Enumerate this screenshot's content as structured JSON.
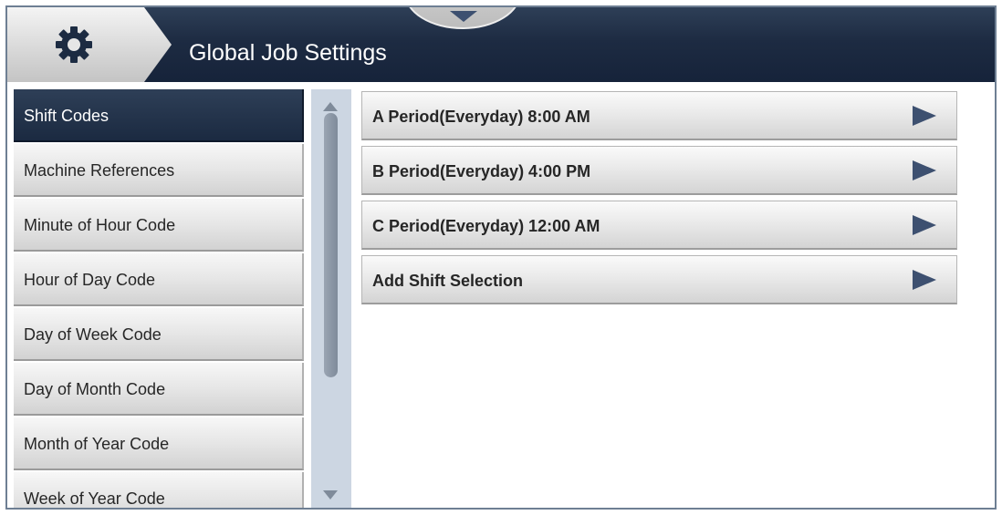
{
  "header": {
    "title": "Global Job Settings",
    "home_icon": "gear-icon",
    "dropdown_icon": "chevron-down-icon"
  },
  "sidebar": {
    "items": [
      {
        "label": "Shift Codes",
        "active": true
      },
      {
        "label": "Machine References"
      },
      {
        "label": "Minute of Hour Code"
      },
      {
        "label": "Hour of Day Code"
      },
      {
        "label": "Day of Week Code"
      },
      {
        "label": "Day of Month Code"
      },
      {
        "label": "Month of Year Code"
      },
      {
        "label": "Week of Year Code"
      }
    ]
  },
  "main": {
    "rows": [
      {
        "label": "A  Period(Everyday) 8:00 AM"
      },
      {
        "label": "B  Period(Everyday) 4:00 PM"
      },
      {
        "label": "C  Period(Everyday) 12:00 AM"
      },
      {
        "label": "Add Shift Selection"
      }
    ]
  },
  "colors": {
    "header": "#1d2b42",
    "active_item": "#1b2a41",
    "scroll_track": "#ccd6e2",
    "arrow": "#3d5070"
  }
}
